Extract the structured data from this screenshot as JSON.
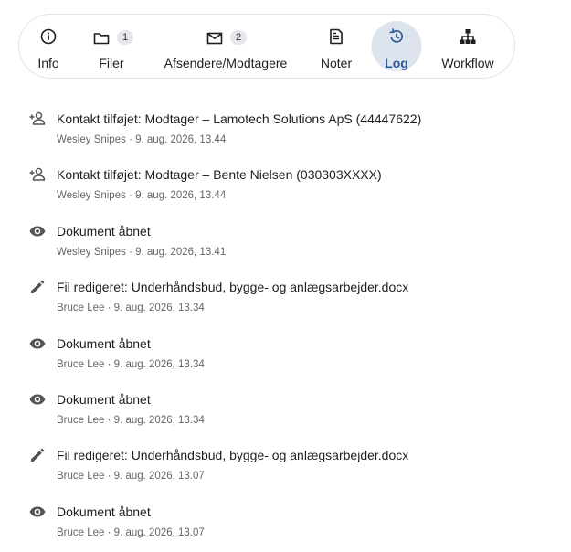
{
  "tabs": [
    {
      "label": "Info",
      "icon": "info-icon"
    },
    {
      "label": "Filer",
      "icon": "folder-icon",
      "badge": "1"
    },
    {
      "label": "Afsendere/Modtagere",
      "icon": "mail-icon",
      "badge": "2"
    },
    {
      "label": "Noter",
      "icon": "note-icon"
    },
    {
      "label": "Log",
      "icon": "history-icon",
      "active": true
    },
    {
      "label": "Workflow",
      "icon": "workflow-icon"
    }
  ],
  "log": [
    {
      "icon": "person-add-icon",
      "title": "Kontakt tilføjet: Modtager – Lamotech Solutions ApS (44447622)",
      "user": "Wesley Snipes",
      "time": "9. aug. 2026, 13.44"
    },
    {
      "icon": "person-add-icon",
      "title": "Kontakt tilføjet: Modtager – Bente Nielsen (030303XXXX)",
      "user": "Wesley Snipes",
      "time": "9. aug. 2026, 13.44"
    },
    {
      "icon": "eye-icon",
      "title": "Dokument åbnet",
      "user": "Wesley Snipes",
      "time": "9. aug. 2026, 13.41"
    },
    {
      "icon": "pencil-icon",
      "title": "Fil redigeret: Underhåndsbud, bygge- og anlægsarbejder.docx",
      "user": "Bruce Lee",
      "time": "9. aug. 2026, 13.34"
    },
    {
      "icon": "eye-icon",
      "title": "Dokument åbnet",
      "user": "Bruce Lee",
      "time": "9. aug. 2026, 13.34"
    },
    {
      "icon": "eye-icon",
      "title": "Dokument åbnet",
      "user": "Bruce Lee",
      "time": "9. aug. 2026, 13.34"
    },
    {
      "icon": "pencil-icon",
      "title": "Fil redigeret: Underhåndsbud, bygge- og anlægsarbejder.docx",
      "user": "Bruce Lee",
      "time": "9. aug. 2026, 13.07"
    },
    {
      "icon": "eye-icon",
      "title": "Dokument åbnet",
      "user": "Bruce Lee",
      "time": "9. aug. 2026, 13.07"
    }
  ],
  "meta_separator": " · ",
  "colors": {
    "accent": "#2e5b9a",
    "active_pill": "#dde4ee",
    "icon": "#555555"
  }
}
